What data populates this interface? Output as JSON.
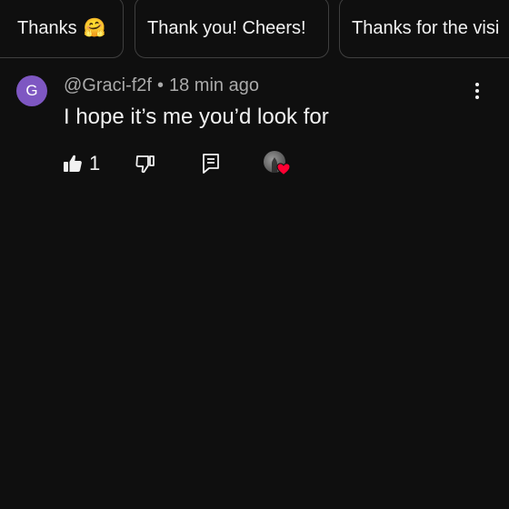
{
  "chips": [
    {
      "label": "Thanks",
      "emoji": "🤗"
    },
    {
      "label": "Thank you! Cheers!"
    },
    {
      "label": "Thanks for the visi"
    }
  ],
  "comment": {
    "avatar_initial": "G",
    "avatar_color": "#7e57c2",
    "author": "@Graci-f2f",
    "separator": "•",
    "time": "18 min ago",
    "text": "I hope it’s me you’d look for",
    "like_count": "1",
    "icons": {
      "more": "more-vert-icon",
      "like": "thumbs-up-icon",
      "dislike": "thumbs-down-icon",
      "reply": "reply-comment-icon",
      "heart": "creator-heart-icon"
    },
    "heart_color": "#ff0033"
  },
  "theme": {
    "background": "#0f0f0f",
    "text": "#f1f1f1",
    "secondary_text": "#aaaaaa",
    "chip_border": "#3f3f3f"
  }
}
